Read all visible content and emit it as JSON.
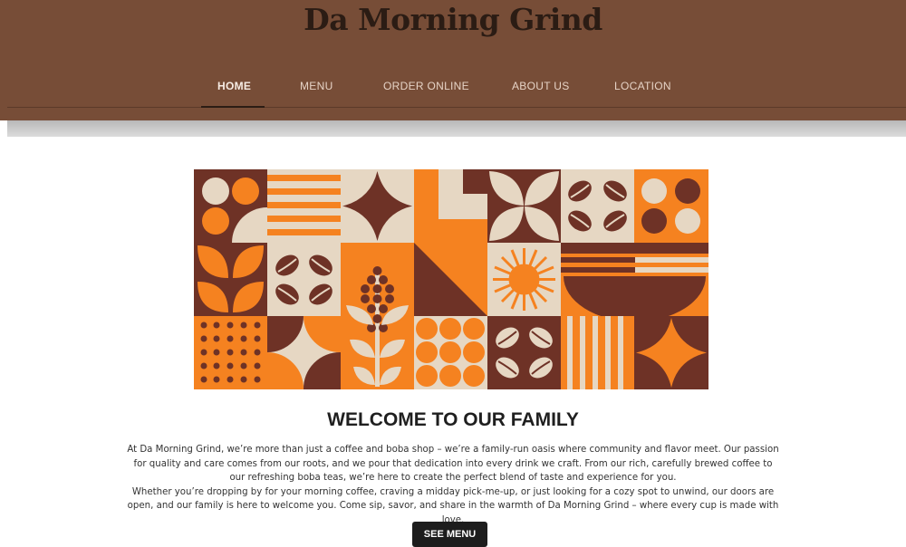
{
  "brand": {
    "name": "Da Morning Grind"
  },
  "nav": {
    "items": [
      {
        "label": "HOME",
        "active": true
      },
      {
        "label": "MENU",
        "active": false
      },
      {
        "label": "ORDER ONLINE",
        "active": false
      },
      {
        "label": "ABOUT US",
        "active": false
      },
      {
        "label": "LOCATION",
        "active": false
      }
    ]
  },
  "hero": {
    "image": "geometric-coffee-pattern"
  },
  "main": {
    "heading": "WELCOME TO OUR FAMILY",
    "paragraph1": "At Da Morning Grind, we’re more than just a coffee and boba shop – we’re a family-run oasis where community and flavor meet. Our passion for quality and care comes from our roots, and we pour that dedication into every drink we craft. From our rich, carefully brewed coffee to our refreshing boba teas, we’re here to create the perfect blend of taste and experience for you.",
    "paragraph2": "Whether you’re dropping by for your morning coffee, craving a midday pick-me-up, or just looking for a cozy spot to unwind, our doors are open, and our family is here to welcome you. Come sip, savor, and share in the warmth of Da Morning Grind – where every cup is made with love.",
    "cta_label": "SEE MENU"
  },
  "colors": {
    "header": "#774d37",
    "accent_orange": "#f58220",
    "cream": "#e6d7c3",
    "dark_brown": "#6e3226",
    "button": "#1d1d1d"
  }
}
